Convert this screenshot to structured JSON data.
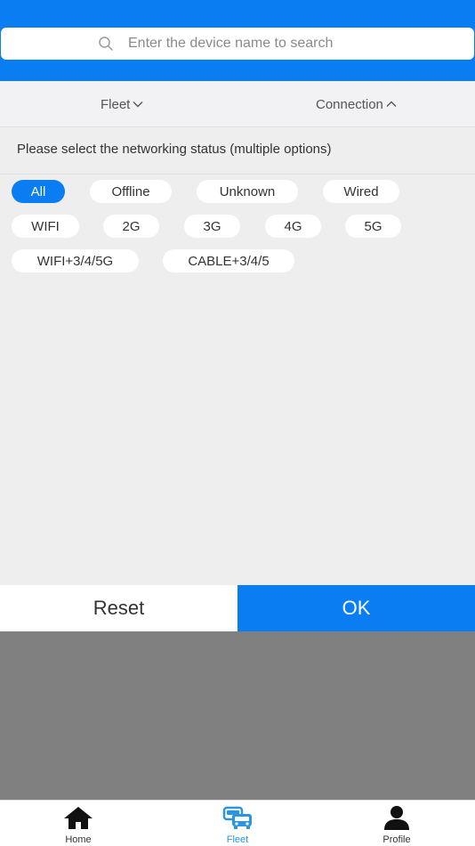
{
  "search": {
    "placeholder": "Enter the device name to search",
    "icon": "search-icon"
  },
  "filters": {
    "fleet_label": "Fleet",
    "connection_label": "Connection"
  },
  "panel": {
    "title": "Please select the networking status (multiple options)",
    "options": [
      "All",
      "Offline",
      "Unknown",
      "Wired",
      "WIFI",
      "2G",
      "3G",
      "4G",
      "5G",
      "WIFI+3/4/5G",
      "CABLE+3/4/5"
    ],
    "selected": "All"
  },
  "actions": {
    "reset_label": "Reset",
    "ok_label": "OK"
  },
  "tabbar": {
    "items": [
      {
        "label": "Home",
        "icon": "home-icon"
      },
      {
        "label": "Fleet",
        "icon": "fleet-icon"
      },
      {
        "label": "Profile",
        "icon": "profile-icon"
      }
    ],
    "active": "Fleet"
  },
  "colors": {
    "accent": "#0a7df2",
    "panel_bg": "#eeeeee",
    "overlay": "#808080",
    "tab_active": "#2b95e0"
  }
}
